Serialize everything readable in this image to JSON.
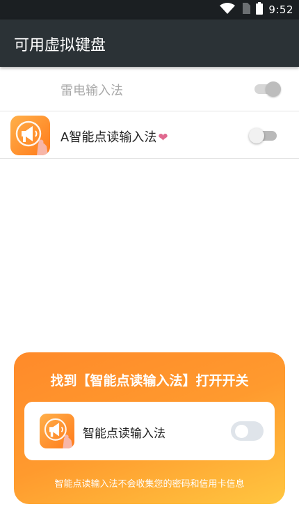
{
  "status_bar": {
    "time": "9:52",
    "icons": [
      "wifi-icon",
      "sim-icon",
      "battery-icon"
    ]
  },
  "app_bar": {
    "title": "可用虚拟键盘"
  },
  "keyboards": [
    {
      "name": "雷电输入法",
      "enabled": true,
      "disabled_style": true
    },
    {
      "name": "A智能点读输入法",
      "suffix": "❤",
      "enabled": false
    }
  ],
  "guide": {
    "title": "找到【智能点读输入法】打开开关",
    "item_label": "智能点读输入法",
    "note": "智能点读输入法不会收集您的密码和信用卡信息"
  },
  "colors": {
    "app_bar": "#2b3236",
    "status_bar": "#1b1f22",
    "accent_orange": "#ff8a2a",
    "accent_yellow": "#ffc640",
    "heart": "#e0698f"
  }
}
